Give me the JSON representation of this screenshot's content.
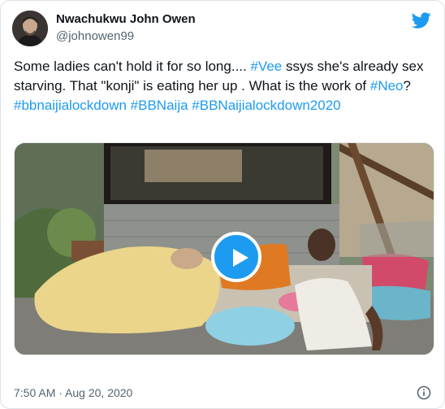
{
  "tweet": {
    "author_name": "Nwachukwu John Owen",
    "author_handle": "@johnowen99",
    "text_parts": [
      {
        "text": "Some ladies can't hold it for so long.... ",
        "type": "plain"
      },
      {
        "text": "#Vee",
        "type": "hashtag"
      },
      {
        "text": " ssys she's already sex starving.  That \"konji\" is eating her up . What is the work of ",
        "type": "plain"
      },
      {
        "text": "#Neo",
        "type": "hashtag"
      },
      {
        "text": "?",
        "type": "plain"
      },
      {
        "text": "#bbnaijialockdown",
        "type": "hashtag"
      },
      {
        "text": " ",
        "type": "plain"
      },
      {
        "text": "#BBNaija",
        "type": "hashtag"
      },
      {
        "text": " ",
        "type": "plain"
      },
      {
        "text": "#BBNaijialockdown2020",
        "type": "hashtag"
      }
    ],
    "time": "7:50 AM",
    "separator": " · ",
    "date": "Aug 20, 2020"
  },
  "icons": {
    "logo": "twitter-bird-icon",
    "play": "play-icon",
    "info": "info-icon"
  },
  "colors": {
    "accent": "#1d9bf0",
    "text": "#0f1419",
    "secondary": "#536471"
  }
}
